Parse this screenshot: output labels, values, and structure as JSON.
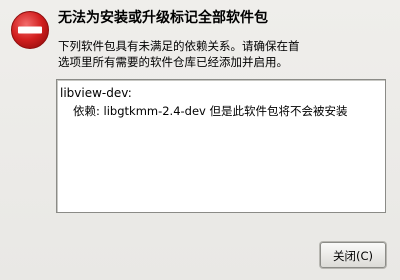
{
  "dialog": {
    "icon": "error-icon",
    "title": "无法为安装或升级标记全部软件包",
    "message_lines": [
      "下列软件包具有未满足的依赖关系。请确保在首",
      "选项里所有需要的软件仓库已经添加并启用。"
    ],
    "details": {
      "package": "libview-dev:",
      "dependency": "依赖: libgtkmm-2.4-dev 但是此软件包将不会被安装"
    },
    "close_button": "关闭(C)"
  },
  "colors": {
    "error_red": "#d21f1f",
    "background": "#ecebe8"
  }
}
